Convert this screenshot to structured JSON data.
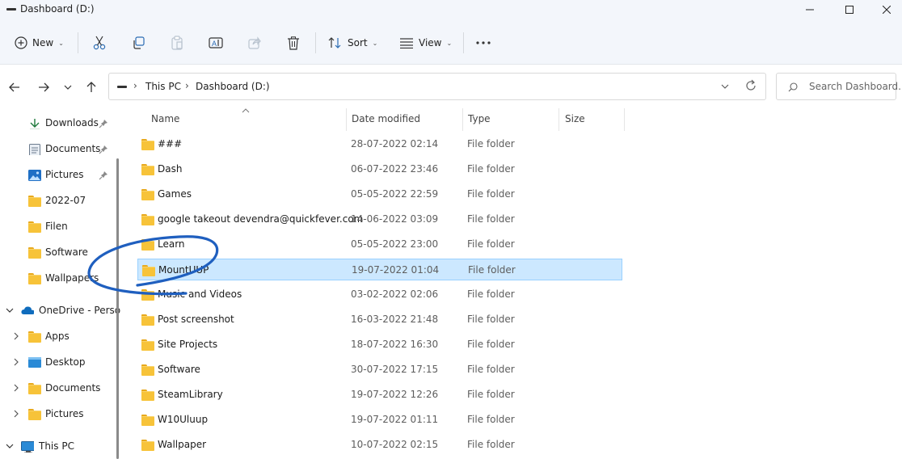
{
  "window": {
    "title": "Dashboard (D:)"
  },
  "toolbar": {
    "new_label": "New",
    "sort_label": "Sort",
    "view_label": "View"
  },
  "address": {
    "crumbs": [
      "This PC",
      "Dashboard (D:)"
    ],
    "search_placeholder": "Search Dashboard..."
  },
  "sidebar": {
    "quick_access": [
      {
        "label": "Downloads",
        "icon": "download-icon",
        "pinned": true
      },
      {
        "label": "Documents",
        "icon": "document-icon",
        "pinned": true
      },
      {
        "label": "Pictures",
        "icon": "pictures-icon",
        "pinned": true
      },
      {
        "label": "2022-07",
        "icon": "folder-icon",
        "pinned": false
      },
      {
        "label": "Filen",
        "icon": "folder-icon",
        "pinned": false
      },
      {
        "label": "Software",
        "icon": "folder-icon",
        "pinned": false
      },
      {
        "label": "Wallpapers",
        "icon": "folder-icon",
        "pinned": false
      }
    ],
    "onedrive": {
      "label": "OneDrive - Perso",
      "children": [
        "Apps",
        "Desktop",
        "Documents",
        "Pictures"
      ]
    },
    "thispc": {
      "label": "This PC"
    }
  },
  "columns": {
    "name": "Name",
    "date": "Date modified",
    "type": "Type",
    "size": "Size"
  },
  "files": [
    {
      "name": "###",
      "date": "28-07-2022 02:14",
      "type": "File folder"
    },
    {
      "name": "Dash",
      "date": "06-07-2022 23:46",
      "type": "File folder"
    },
    {
      "name": "Games",
      "date": "05-05-2022 22:59",
      "type": "File folder"
    },
    {
      "name": "google takeout devendra@quickfever.com",
      "date": "14-06-2022 03:09",
      "type": "File folder"
    },
    {
      "name": "Learn",
      "date": "05-05-2022 23:00",
      "type": "File folder"
    },
    {
      "name": "MountUUP",
      "date": "19-07-2022 01:04",
      "type": "File folder",
      "selected": true
    },
    {
      "name": "Music and Videos",
      "date": "03-02-2022 02:06",
      "type": "File folder"
    },
    {
      "name": "Post screenshot",
      "date": "16-03-2022 21:48",
      "type": "File folder"
    },
    {
      "name": "Site Projects",
      "date": "18-07-2022 16:30",
      "type": "File folder"
    },
    {
      "name": "Software",
      "date": "30-07-2022 17:15",
      "type": "File folder"
    },
    {
      "name": "SteamLibrary",
      "date": "19-07-2022 12:26",
      "type": "File folder"
    },
    {
      "name": "W10Uluup",
      "date": "19-07-2022 01:11",
      "type": "File folder"
    },
    {
      "name": "Wallpaper",
      "date": "10-07-2022 02:15",
      "type": "File folder"
    }
  ],
  "colors": {
    "selection_bg": "#cce8ff",
    "selection_border": "#99d1ff",
    "folder": "#f7c339",
    "annotation": "#1f5fbf",
    "accent": "#0067c0"
  }
}
